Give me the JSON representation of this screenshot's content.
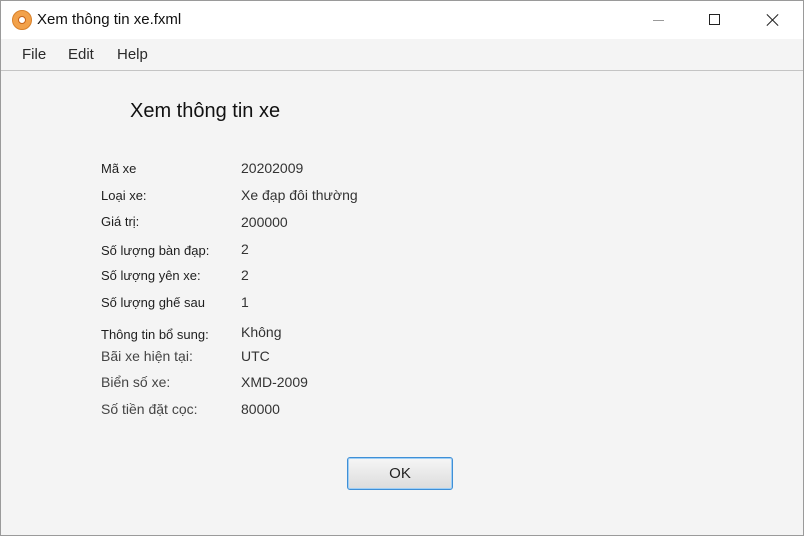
{
  "window": {
    "title": "Xem thông tin xe.fxml"
  },
  "menu": {
    "file": "File",
    "edit": "Edit",
    "help": "Help"
  },
  "page": {
    "heading": "Xem thông tin xe"
  },
  "fields": [
    {
      "label": "Mã xe",
      "value": "20202009"
    },
    {
      "label": "Loại xe:",
      "value": "Xe đạp đôi thường"
    },
    {
      "label": "Giá trị:",
      "value": "200000"
    },
    {
      "label": "Số lượng bàn đạp:",
      "value": "2"
    },
    {
      "label": "Số lượng yên xe:",
      "value": "2"
    },
    {
      "label": "Số lượng ghế sau",
      "value": "1"
    },
    {
      "label": "Thông tin bổ sung:",
      "value": "Không"
    },
    {
      "label": "Bãi xe hiện tại:",
      "value": "UTC"
    },
    {
      "label": "Biển số xe:",
      "value": "XMD-2009"
    },
    {
      "label": "Số tiền đặt cọc:",
      "value": "80000"
    }
  ],
  "buttons": {
    "ok": "OK"
  }
}
